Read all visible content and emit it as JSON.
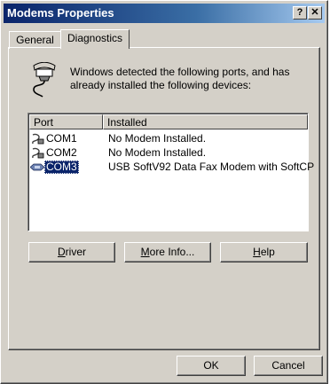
{
  "window": {
    "title": "Modems Properties",
    "help_btn": "?",
    "close_btn": "✕"
  },
  "tabs": [
    {
      "label": "General"
    },
    {
      "label": "Diagnostics"
    }
  ],
  "info": {
    "text": "Windows detected the following ports, and has already installed the following devices:",
    "icon": "modem-icon"
  },
  "list": {
    "headers": {
      "port": "Port",
      "installed": "Installed"
    },
    "rows": [
      {
        "port": "COM1",
        "installed": "No Modem Installed.",
        "icon": "serial-port-icon"
      },
      {
        "port": "COM2",
        "installed": "No Modem Installed.",
        "icon": "serial-port-icon"
      },
      {
        "port": "COM3",
        "installed": "USB SoftV92 Data Fax Modem with SoftCP",
        "icon": "usb-modem-icon",
        "selected": true
      }
    ]
  },
  "buttons": {
    "driver": {
      "first": "D",
      "rest": "river"
    },
    "more_info": {
      "first": "M",
      "rest": "ore Info..."
    },
    "help": {
      "first": "H",
      "rest": "elp"
    },
    "ok": "OK",
    "cancel": "Cancel"
  },
  "colors": {
    "face": "#d4d0c8",
    "title_start": "#0a246a",
    "title_end": "#a6caf0",
    "selection": "#0a246a"
  }
}
